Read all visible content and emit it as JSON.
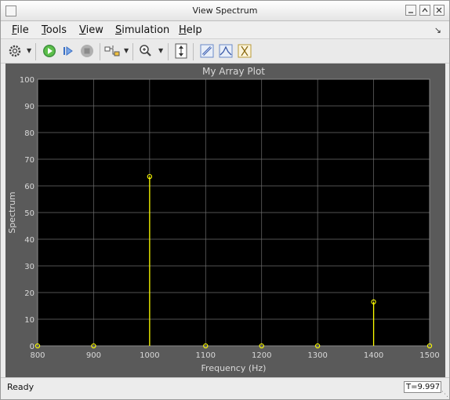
{
  "window": {
    "title": "View Spectrum"
  },
  "menu": {
    "items": [
      {
        "label": "File",
        "ul": "F"
      },
      {
        "label": "Tools",
        "ul": "T"
      },
      {
        "label": "View",
        "ul": "V"
      },
      {
        "label": "Simulation",
        "ul": "S"
      },
      {
        "label": "Help",
        "ul": "H"
      }
    ]
  },
  "toolbar": {
    "icons": [
      "settings-icon",
      "run-icon",
      "step-forward-icon",
      "stop-icon",
      "signal-select-icon",
      "zoom-icon",
      "scale-axes-icon",
      "cursor-measurements-icon",
      "peak-finder-icon",
      "signal-stats-icon"
    ]
  },
  "status": {
    "text": "Ready",
    "time": "T=9.997"
  },
  "colors": {
    "plot_bg": "#000000",
    "axes_bg": "#5a5a5a",
    "stem": "#ffff00",
    "grid": "#6e6e6e",
    "label": "#d9d9d9"
  },
  "chart_data": {
    "type": "stem",
    "title": "My Array Plot",
    "xlabel": "Frequency (Hz)",
    "ylabel": "Spectrum",
    "xlim": [
      800,
      1500
    ],
    "ylim": [
      0,
      100
    ],
    "xticks": [
      "800",
      "900",
      "1000",
      "1100",
      "1200",
      "1300",
      "1400",
      "1500"
    ],
    "yticks": [
      "0",
      "10",
      "20",
      "30",
      "40",
      "50",
      "60",
      "70",
      "80",
      "90",
      "100"
    ],
    "grid": true,
    "series": [
      {
        "x": [
          800,
          900,
          1000,
          1100,
          1200,
          1300,
          1400,
          1500
        ],
        "y": [
          0,
          0,
          63.5,
          0,
          0,
          0,
          16.5,
          0
        ]
      }
    ]
  }
}
